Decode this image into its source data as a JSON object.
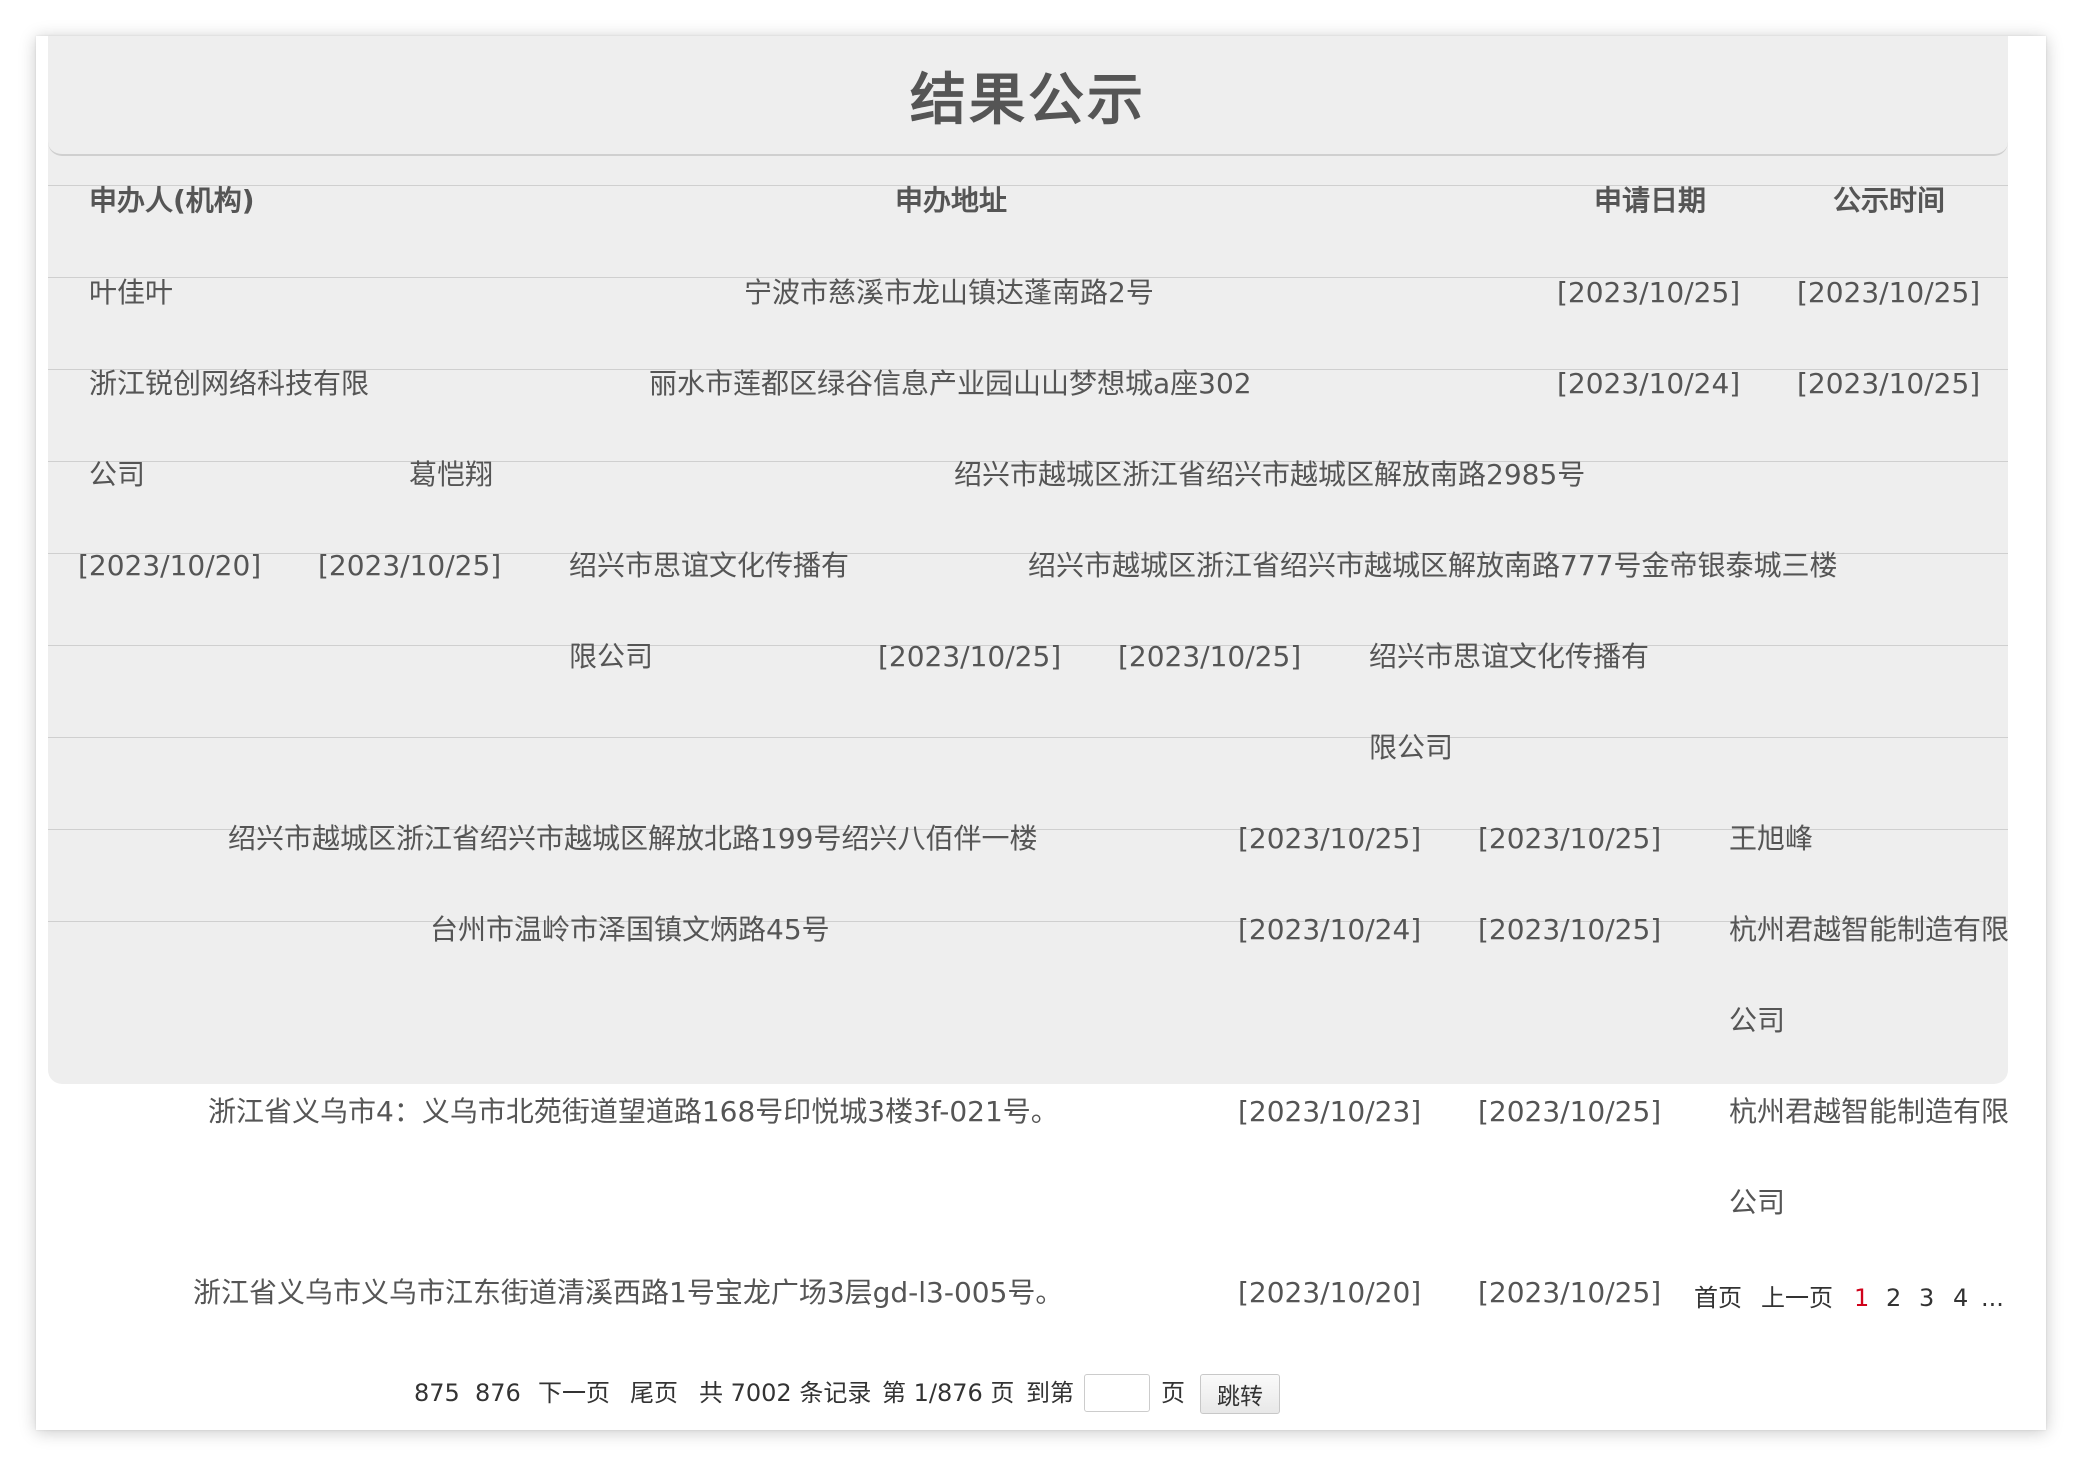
{
  "title": "结果公示",
  "headers": {
    "applicant": "申办人(机构)",
    "address": "申办地址",
    "apply_date": "申请日期",
    "publish_date": "公示时间"
  },
  "records": [
    {
      "applicant": "叶佳叶",
      "address": "宁波市慈溪市龙山镇达蓬南路2号",
      "apply_date": "[2023/10/25]",
      "publish_date": "[2023/10/25]"
    },
    {
      "applicant_l1": "浙江锐创网络科技有限",
      "applicant_l2": "公司",
      "address": "丽水市莲都区绿谷信息产业园山山梦想城a座302",
      "apply_date": "[2023/10/24]",
      "publish_date": "[2023/10/25]"
    },
    {
      "applicant": "葛恺翔",
      "address": "绍兴市越城区浙江省绍兴市越城区解放南路2985号",
      "apply_date": "[2023/10/20]",
      "publish_date": "[2023/10/25]"
    },
    {
      "applicant_l1": "绍兴市思谊文化传播有",
      "applicant_l2": "限公司",
      "address": "绍兴市越城区浙江省绍兴市越城区解放南路777号金帝银泰城三楼",
      "apply_date": "[2023/10/25]",
      "publish_date": "[2023/10/25]"
    },
    {
      "applicant_l1": "绍兴市思谊文化传播有",
      "applicant_l2": "限公司",
      "address": "绍兴市越城区浙江省绍兴市越城区解放北路199号绍兴八佰伴一楼",
      "apply_date": "[2023/10/25]",
      "publish_date": "[2023/10/25]"
    },
    {
      "applicant": "王旭峰",
      "address": "台州市温岭市泽国镇文炳路45号",
      "apply_date": "[2023/10/24]",
      "publish_date": "[2023/10/25]"
    },
    {
      "applicant_l1": "杭州君越智能制造有限",
      "applicant_l2": "公司",
      "address": "浙江省义乌市4：义乌市北苑街道望道路168号印悦城3楼3f-021号。",
      "apply_date": "[2023/10/23]",
      "publish_date": "[2023/10/25]"
    },
    {
      "applicant_l1": "杭州君越智能制造有限",
      "applicant_l2": "公司",
      "address": "浙江省义乌市义乌市江东街道清溪西路1号宝龙广场3层gd-l3-005号。",
      "apply_date": "[2023/10/20]",
      "publish_date": "[2023/10/25]"
    }
  ],
  "pagination": {
    "first": "首页",
    "prev": "上一页",
    "current": "1",
    "p2": "2",
    "p3": "3",
    "p4": "4",
    "ellipsis": "...",
    "p875": "875",
    "p876": "876",
    "next": "下一页",
    "last": "尾页",
    "total_text": "共 7002 条记录",
    "page_info": "第 1/876 页",
    "goto_label": "到第",
    "page_unit": "页",
    "goto_button": "跳转"
  }
}
